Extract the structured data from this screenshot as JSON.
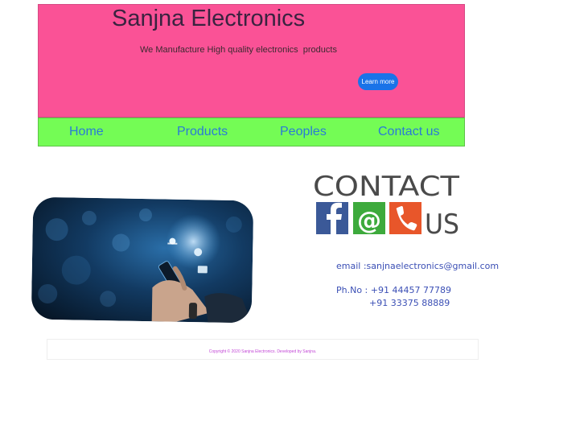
{
  "header": {
    "title": "Sanjna Electronics",
    "tagline": "We Manufacture High quality electronics  products",
    "learn_more_label": "Learn more"
  },
  "nav": {
    "items": [
      "Home",
      "Products",
      "Peoples",
      "Contact us"
    ]
  },
  "contact": {
    "logo_text_top": "CONTACT",
    "logo_text_us": "US",
    "email_line": "email :sanjnaelectronics@gmail.com",
    "phone_label_line": "Ph.No : +91 44457 77789",
    "phone_second": "+91 33375 88889"
  },
  "footer": {
    "text": "Copyright © 2020 Sanjna Electronics. Developed by Sanjna."
  },
  "colors": {
    "hero_bg": "#fa5296",
    "nav_bg": "#74fc55",
    "link": "#2a7ad6",
    "button": "#1a73e8"
  }
}
